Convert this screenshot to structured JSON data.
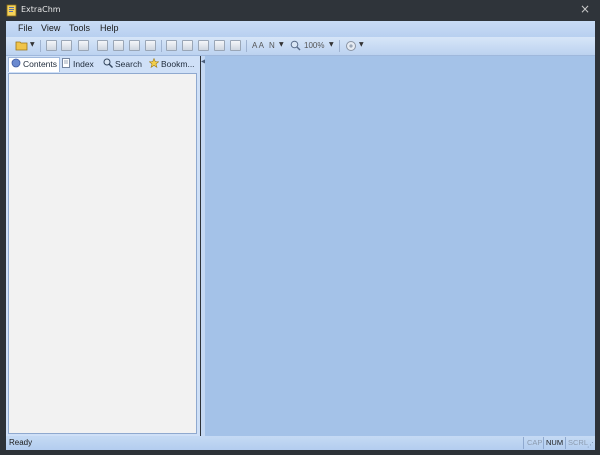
{
  "window": {
    "title": "ExtraChm"
  },
  "menu": {
    "items": [
      "File",
      "View",
      "Tools",
      "Help"
    ]
  },
  "toolbar": {
    "font_label": "A A",
    "n_label": "N",
    "zoom": "100%"
  },
  "tabs": [
    {
      "label": "Contents",
      "icon": "contents-icon"
    },
    {
      "label": "Index",
      "icon": "index-icon"
    },
    {
      "label": "Search",
      "icon": "search-icon"
    },
    {
      "label": "Bookm...",
      "icon": "bookmark-icon"
    }
  ],
  "status": {
    "text": "Ready",
    "indicators": [
      "CAP",
      "NUM",
      "SCRL"
    ]
  },
  "colors": {
    "content_bg": "#a4c2e8",
    "menubar_bg": "#c9dcf5",
    "titlebar_bg": "#2f343a"
  }
}
